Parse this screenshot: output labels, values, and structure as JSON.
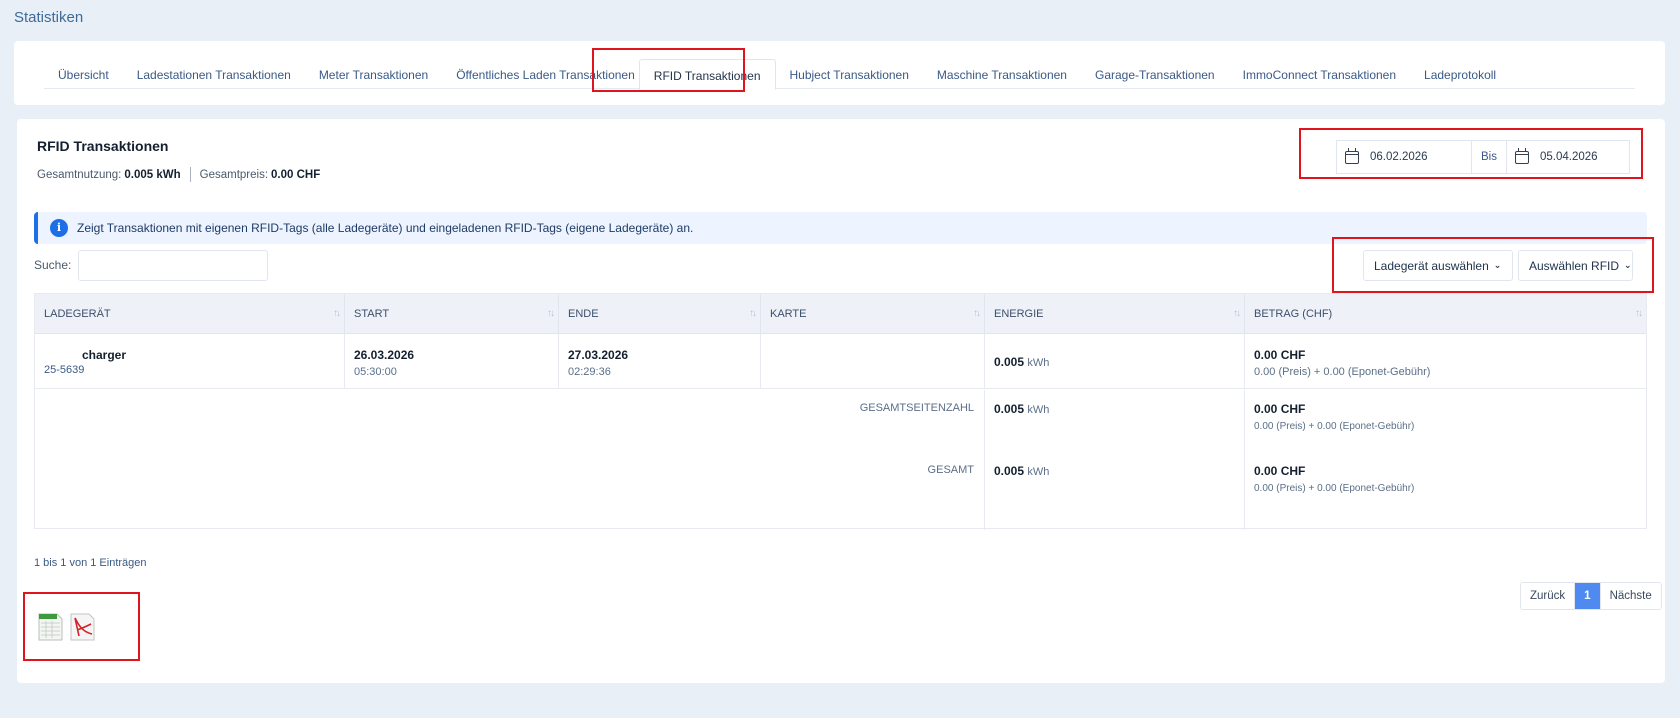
{
  "page": {
    "title": "Statistiken"
  },
  "tabs": [
    {
      "label": "Übersicht"
    },
    {
      "label": "Ladestationen Transaktionen"
    },
    {
      "label": "Meter Transaktionen"
    },
    {
      "label": "Öffentliches Laden Transaktionen"
    },
    {
      "label": "RFID Transaktionen",
      "active": true
    },
    {
      "label": "Hubject Transaktionen"
    },
    {
      "label": "Maschine Transaktionen"
    },
    {
      "label": "Garage-Transaktionen"
    },
    {
      "label": "ImmoConnect Transaktionen"
    },
    {
      "label": "Ladeprotokoll"
    }
  ],
  "section": {
    "title": "RFID Transaktionen",
    "usage_label": "Gesamtnutzung:",
    "usage_value": "0.005 kWh",
    "price_label": "Gesamtpreis:",
    "price_value": "0.00 CHF"
  },
  "date_range": {
    "from": "06.02.2026",
    "separator": "Bis",
    "to": "05.04.2026"
  },
  "info": {
    "icon": "info-icon",
    "glyph": "i",
    "text": "Zeigt Transaktionen mit eigenen RFID-Tags (alle Ladegeräte) und eingeladenen RFID-Tags (eigene Ladegeräte) an."
  },
  "search": {
    "label": "Suche:",
    "placeholder": ""
  },
  "filters": {
    "charger": "Ladegerät auswählen",
    "rfid": "Auswählen RFID"
  },
  "table": {
    "headers": [
      "LADEGERÄT",
      "START",
      "ENDE",
      "KARTE",
      "ENERGIE",
      "BETRAG (CHF)"
    ],
    "rows": [
      {
        "charger_name": "charger",
        "charger_id": "25-5639",
        "start_date": "26.03.2026",
        "start_time": "05:30:00",
        "end_date": "27.03.2026",
        "end_time": "02:29:36",
        "card": "",
        "energy": "0.005",
        "energy_unit": "kWh",
        "amount": "0.00 CHF",
        "amount_detail": "0.00 (Preis)  +  0.00 (Eponet-Gebühr)"
      }
    ],
    "page_total": {
      "label": "GESAMTSEITENZAHL",
      "energy": "0.005",
      "energy_unit": "kWh",
      "amount": "0.00 CHF",
      "amount_detail": "0.00 (Preis) + 0.00 (Eponet-Gebühr)"
    },
    "grand_total": {
      "label": "GESAMT",
      "energy": "0.005",
      "energy_unit": "kWh",
      "amount": "0.00 CHF",
      "amount_detail": "0.00 (Preis) + 0.00 (Eponet-Gebühr)"
    }
  },
  "entries_info": "1 bis 1 von 1 Einträgen",
  "pagination": {
    "prev": "Zurück",
    "current": "1",
    "next": "Nächste"
  },
  "exports": [
    {
      "icon": "excel-export-icon"
    },
    {
      "icon": "pdf-export-icon"
    }
  ],
  "colors": {
    "accent": "#1c6fe6",
    "highlight": "#e0141c",
    "pager_active": "#4e8af0",
    "background": "#e9eff7"
  }
}
